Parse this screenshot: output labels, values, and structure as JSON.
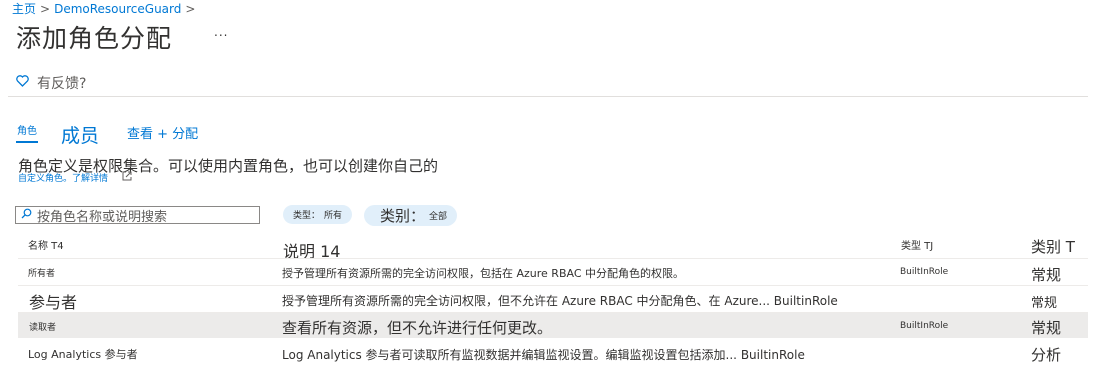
{
  "breadcrumb": {
    "home": "主页",
    "separator": ">",
    "resource": "DemoResourceGuard"
  },
  "page": {
    "title": "添加角色分配",
    "more": "..."
  },
  "feedback": {
    "icon": "heart-icon",
    "label": "有反馈?"
  },
  "tabs": [
    {
      "label": "角色",
      "selected": true
    },
    {
      "label": "成员",
      "selected": false
    },
    {
      "label": "查看 + 分配",
      "selected": false
    }
  ],
  "description": {
    "text": "角色定义是权限集合。可以使用内置角色，也可以创建你自己的",
    "link": "自定义角色。了解详情",
    "link_icon": "external-link-icon"
  },
  "filters": {
    "search_placeholder": "按角色名称或说明搜索",
    "type_key": "类型：",
    "type_value": "所有",
    "category_key": "类别：",
    "category_value": "全部"
  },
  "table": {
    "columns": [
      "名称 T4",
      "说明 14",
      "类型 TJ",
      "类别 T"
    ],
    "rows": [
      {
        "name": "所有者",
        "description": "授予管理所有资源所需的完全访问权限，包括在 Azure RBAC 中分配角色的权限。",
        "type": "BuiltInRole",
        "category": "常规",
        "selected": false
      },
      {
        "name": "参与者",
        "description": "授予管理所有资源所需的完全访问权限，但不允许在 Azure  RBAC 中分配角色、在 Azure... BuiltinRole",
        "type": "",
        "category": "常规",
        "selected": false
      },
      {
        "name": "读取者",
        "description": "查看所有资源，但不允许进行任何更改。",
        "type": "BuiltInRole",
        "category": "常规",
        "selected": true
      },
      {
        "name": "Log Analytics 参与者",
        "description": "Log  Analytics 参与者可读取所有监视数据并编辑监视设置。编辑监视设置包括添加... BuiltinRole",
        "type": "",
        "category": "分析",
        "selected": false
      }
    ]
  },
  "colors": {
    "accent": "#0078d4",
    "selected_row": "#ecebea",
    "pill": "#e1effa"
  }
}
